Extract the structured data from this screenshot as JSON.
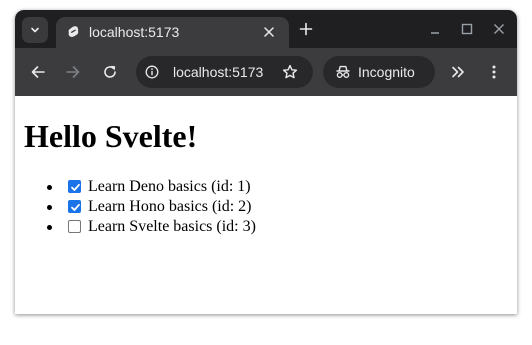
{
  "browser": {
    "tab": {
      "title": "localhost:5173"
    },
    "address_bar": {
      "url": "localhost:5173"
    },
    "profile_chip": {
      "label": "Incognito"
    }
  },
  "page": {
    "heading": "Hello Svelte!",
    "todos": [
      {
        "label": "Learn Deno basics (id: 1)",
        "checked": true
      },
      {
        "label": "Learn Hono basics (id: 2)",
        "checked": true
      },
      {
        "label": "Learn Svelte basics (id: 3)",
        "checked": false
      }
    ]
  },
  "colors": {
    "chrome_dark": "#1f1f21",
    "toolbar": "#3c3c3f",
    "checkbox_checked": "#1a73e8"
  }
}
